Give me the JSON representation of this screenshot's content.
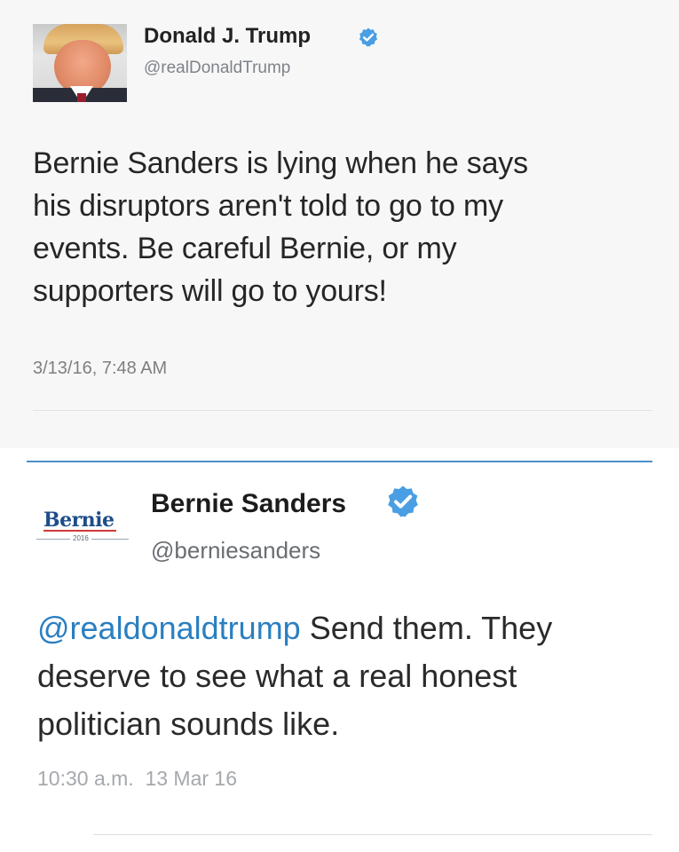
{
  "tweets": [
    {
      "name": "Donald J. Trump",
      "handle": "@realDonaldTrump",
      "verified": true,
      "text_lines": [
        "Bernie Sanders is lying when he says",
        "his disruptors aren't told to go to my",
        "events. Be careful Bernie, or my",
        "supporters will go to yours!"
      ],
      "timestamp": "3/13/16, 7:48 AM"
    },
    {
      "name": "Bernie Sanders",
      "handle": "@berniesanders",
      "verified": true,
      "logo": {
        "wordmark": "Bernie",
        "year": "2016"
      },
      "mention": "@realdonaldtrump",
      "text_lines": [
        " Send them. They",
        "deserve to see what a real honest",
        "politician sounds like."
      ],
      "timestamp": "10:30 a.m.  13 Mar 16"
    }
  ],
  "colors": {
    "verified_badge": "#4a9ee3",
    "mention_link": "#2a7fc1",
    "separator": "#4a90c9",
    "logo_blue": "#1d4e89",
    "logo_red": "#d13a3a"
  },
  "icons": {
    "verified": "verified-badge-icon"
  }
}
